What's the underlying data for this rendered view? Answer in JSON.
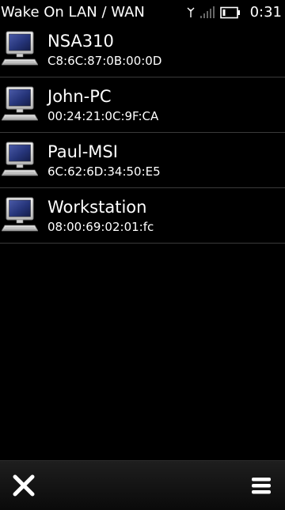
{
  "app": {
    "title": "Wake On LAN / WAN"
  },
  "status_bar": {
    "time": "0:31",
    "icons": [
      "antenna-icon",
      "signal-strength-icon",
      "battery-icon"
    ]
  },
  "devices": [
    {
      "name": "NSA310",
      "mac": "C8:6C:87:0B:00:0D",
      "icon": "computer-icon"
    },
    {
      "name": "John-PC",
      "mac": "00:24:21:0C:9F:CA",
      "icon": "computer-icon"
    },
    {
      "name": "Paul-MSI",
      "mac": "6C:62:6D:34:50:E5",
      "icon": "computer-icon"
    },
    {
      "name": "Workstation",
      "mac": "08:00:69:02:01:fc",
      "icon": "computer-icon"
    }
  ],
  "toolbar": {
    "left_icon": "close-icon",
    "right_icon": "menu-icon"
  },
  "colors": {
    "background": "#000000",
    "text": "#ffffff",
    "divider": "#3a3a3a",
    "screen_blue": "#26357a"
  }
}
